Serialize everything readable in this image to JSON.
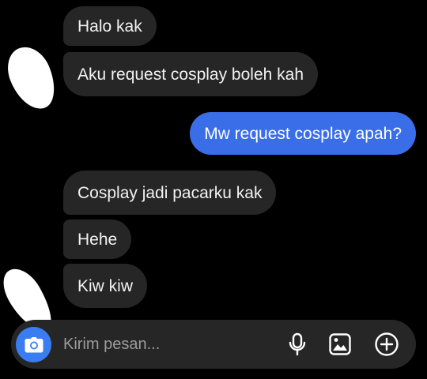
{
  "messages": [
    {
      "side": "incoming",
      "text": "Halo kak"
    },
    {
      "side": "incoming",
      "text": "Aku request cosplay boleh kah"
    },
    {
      "side": "outgoing",
      "text": "Mw request cosplay apah?"
    },
    {
      "side": "incoming",
      "text": "Cosplay jadi pacarku kak"
    },
    {
      "side": "incoming",
      "text": "Hehe"
    },
    {
      "side": "incoming",
      "text": "Kiw kiw"
    }
  ],
  "composer": {
    "placeholder": "Kirim pesan...",
    "icons": [
      "camera-icon",
      "microphone-icon",
      "gallery-icon",
      "add-icon"
    ]
  },
  "colors": {
    "background": "#000000",
    "incoming_bubble": "#262626",
    "outgoing_bubble": "#3a6ee8",
    "camera_button": "#3a7df1"
  }
}
